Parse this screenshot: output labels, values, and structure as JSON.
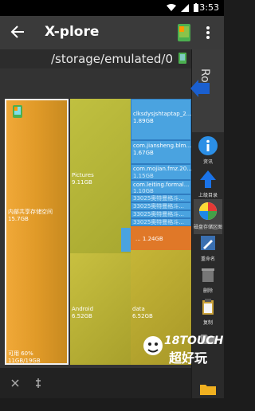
{
  "status": {
    "time": "3:53"
  },
  "appbar": {
    "title": "X-plore"
  },
  "pathbar": {
    "path": "/storage/emulated/0"
  },
  "sidebar": {
    "root_label": "Root",
    "items": [
      {
        "label": "资讯"
      },
      {
        "label": "上级目录"
      },
      {
        "label": "磁盘存储区图"
      },
      {
        "label": "重命名"
      },
      {
        "label": "删除"
      },
      {
        "label": "复制"
      }
    ]
  },
  "map": {
    "internal": {
      "name": "内部共享存储空间",
      "size": "15.7GB",
      "usage": "可用 60%",
      "ratio": "11GB/19GB"
    },
    "pictures": {
      "name": "Pictures",
      "size": "9.11GB"
    },
    "android": {
      "name": "Android",
      "size": "6.52GB"
    },
    "data": {
      "name": "data",
      "size": "6.52GB"
    },
    "files": [
      {
        "name": "clksdysjshtaptap_2...",
        "size": "1.89GB"
      },
      {
        "name": "com.jiansheng.blm...",
        "size": "1.67GB"
      },
      {
        "name": "com.mojian.fmz.20...",
        "size": "1.15GB"
      },
      {
        "name": "com.leiting.formal...",
        "size": "1.10GB"
      },
      {
        "name": "33025奥特曼格斗...",
        "size": ""
      },
      {
        "name": "33025奥特曼格斗...",
        "size": ""
      },
      {
        "name": "33025奥特曼格斗...",
        "size": ""
      },
      {
        "name": "33025奥特曼格斗...",
        "size": ""
      }
    ],
    "other": {
      "size": "... 1.24GB"
    }
  },
  "watermark": {
    "text": "18TOUCH",
    "sub": "超好玩"
  },
  "colors": {
    "accent": "#1a73e8",
    "orange": "#e8a030",
    "olive": "#b5b530",
    "blue": "#4aa3e0"
  }
}
